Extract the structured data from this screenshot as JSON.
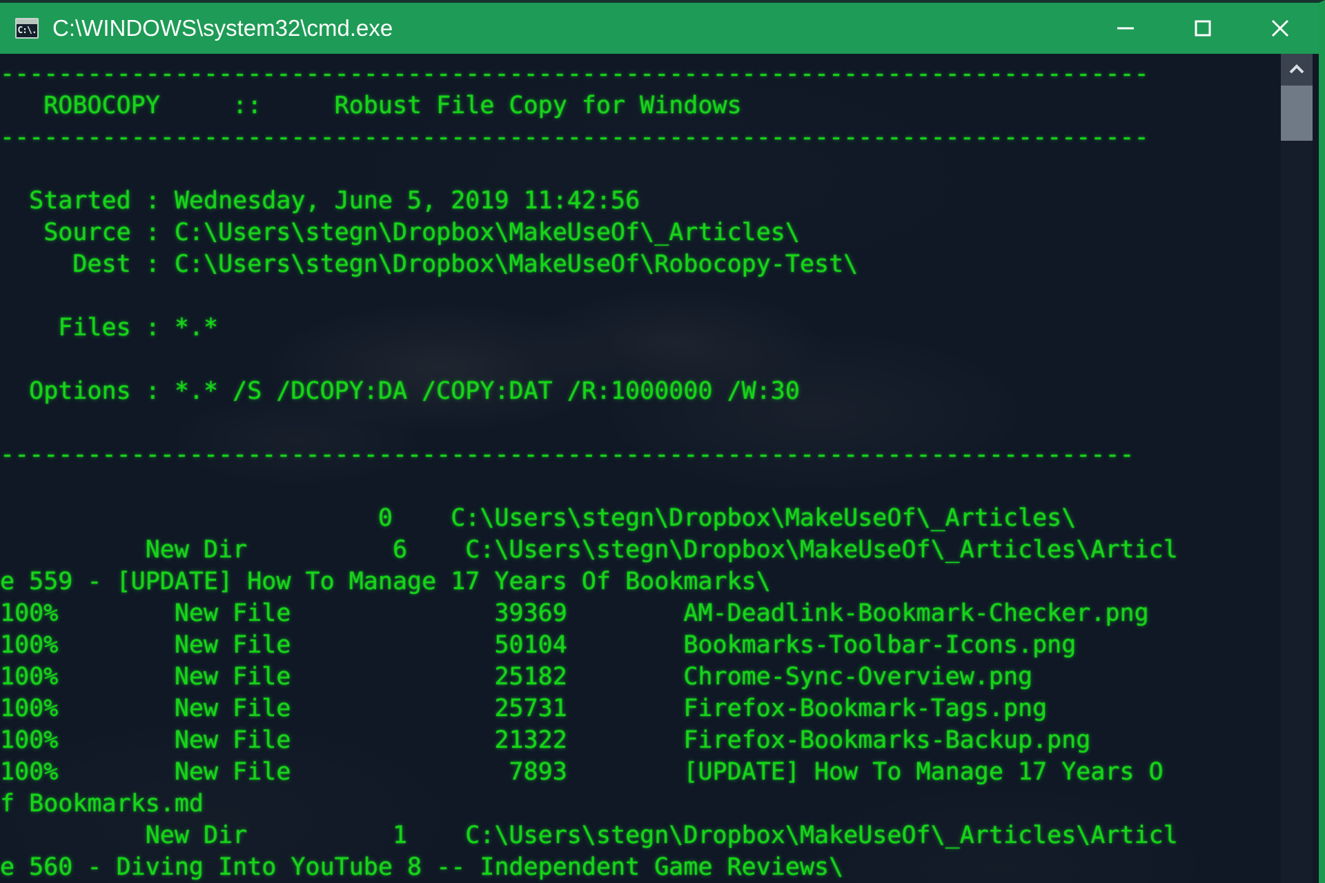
{
  "window": {
    "title": "C:\\WINDOWS\\system32\\cmd.exe",
    "icon_label": "C:\\.",
    "accent_color": "#1e9b56",
    "console_bg": "#101826",
    "text_color": "#17d417"
  },
  "titlebar": {
    "minimize_label": "Minimize",
    "maximize_label": "Maximize",
    "close_label": "Close"
  },
  "scrollbar": {
    "up_arrow_label": "Scroll up",
    "thumb_label": "Scroll thumb"
  },
  "console": {
    "lines": [
      "-------------------------------------------------------------------------------",
      "   ROBOCOPY     ::     Robust File Copy for Windows",
      "-------------------------------------------------------------------------------",
      "",
      "  Started : Wednesday, June 5, 2019 11:42:56",
      "   Source : C:\\Users\\stegn\\Dropbox\\MakeUseOf\\_Articles\\",
      "     Dest : C:\\Users\\stegn\\Dropbox\\MakeUseOf\\Robocopy-Test\\",
      "",
      "    Files : *.*",
      "",
      "  Options : *.* /S /DCOPY:DA /COPY:DAT /R:1000000 /W:30",
      "",
      "------------------------------------------------------------------------------",
      "",
      "                          0    C:\\Users\\stegn\\Dropbox\\MakeUseOf\\_Articles\\",
      "          New Dir          6    C:\\Users\\stegn\\Dropbox\\MakeUseOf\\_Articles\\Articl",
      "e 559 - [UPDATE] How To Manage 17 Years Of Bookmarks\\",
      "100%        New File              39369        AM-Deadlink-Bookmark-Checker.png",
      "100%        New File              50104        Bookmarks-Toolbar-Icons.png",
      "100%        New File              25182        Chrome-Sync-Overview.png",
      "100%        New File              25731        Firefox-Bookmark-Tags.png",
      "100%        New File              21322        Firefox-Bookmarks-Backup.png",
      "100%        New File               7893        [UPDATE] How To Manage 17 Years O",
      "f Bookmarks.md",
      "          New Dir          1    C:\\Users\\stegn\\Dropbox\\MakeUseOf\\_Articles\\Articl",
      "e 560 - Diving Into YouTube 8 -- Independent Game Reviews\\"
    ],
    "program_name": "ROBOCOPY",
    "program_separator": "::",
    "program_description": "Robust File Copy for Windows",
    "started": "Wednesday, June 5, 2019 11:42:56",
    "source": "C:\\Users\\stegn\\Dropbox\\MakeUseOf\\_Articles\\",
    "dest": "C:\\Users\\stegn\\Dropbox\\MakeUseOf\\Robocopy-Test\\",
    "files_filter": "*.*",
    "options": "*.* /S /DCOPY:DA /COPY:DAT /R:1000000 /W:30",
    "entries": [
      {
        "percent": "",
        "type": "",
        "size": "0",
        "name": "C:\\Users\\stegn\\Dropbox\\MakeUseOf\\_Articles\\"
      },
      {
        "percent": "",
        "type": "New Dir",
        "size": "6",
        "name": "C:\\Users\\stegn\\Dropbox\\MakeUseOf\\_Articles\\Article 559 - [UPDATE] How To Manage 17 Years Of Bookmarks\\"
      },
      {
        "percent": "100%",
        "type": "New File",
        "size": "39369",
        "name": "AM-Deadlink-Bookmark-Checker.png"
      },
      {
        "percent": "100%",
        "type": "New File",
        "size": "50104",
        "name": "Bookmarks-Toolbar-Icons.png"
      },
      {
        "percent": "100%",
        "type": "New File",
        "size": "25182",
        "name": "Chrome-Sync-Overview.png"
      },
      {
        "percent": "100%",
        "type": "New File",
        "size": "25731",
        "name": "Firefox-Bookmark-Tags.png"
      },
      {
        "percent": "100%",
        "type": "New File",
        "size": "21322",
        "name": "Firefox-Bookmarks-Backup.png"
      },
      {
        "percent": "100%",
        "type": "New File",
        "size": "7893",
        "name": "[UPDATE] How To Manage 17 Years Of Bookmarks.md"
      },
      {
        "percent": "",
        "type": "New Dir",
        "size": "1",
        "name": "C:\\Users\\stegn\\Dropbox\\MakeUseOf\\_Articles\\Article 560 - Diving Into YouTube 8 -- Independent Game Reviews\\"
      }
    ]
  }
}
